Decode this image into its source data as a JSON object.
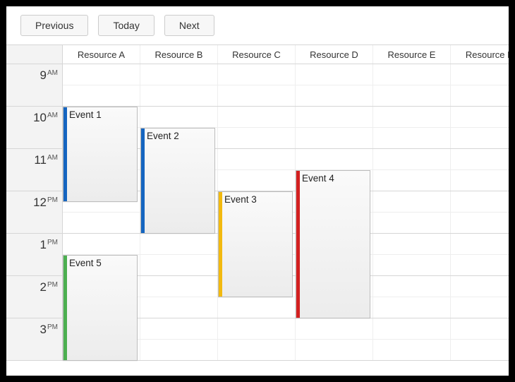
{
  "toolbar": {
    "previous": "Previous",
    "today": "Today",
    "next": "Next"
  },
  "resources": [
    "Resource A",
    "Resource B",
    "Resource C",
    "Resource D",
    "Resource E",
    "Resource F"
  ],
  "startHour": 9,
  "hours": [
    {
      "num": "9",
      "ampm": "AM"
    },
    {
      "num": "10",
      "ampm": "AM"
    },
    {
      "num": "11",
      "ampm": "AM"
    },
    {
      "num": "12",
      "ampm": "PM"
    },
    {
      "num": "1",
      "ampm": "PM"
    },
    {
      "num": "2",
      "ampm": "PM"
    },
    {
      "num": "3",
      "ampm": "PM"
    }
  ],
  "colors": {
    "blue": "#1565c0",
    "yellow": "#f2b90f",
    "red": "#d32020",
    "green": "#4caf50"
  },
  "events": [
    {
      "title": "Event 1",
      "resource": 0,
      "start": 10.0,
      "end": 12.25,
      "color": "blue"
    },
    {
      "title": "Event 2",
      "resource": 1,
      "start": 10.5,
      "end": 13.0,
      "color": "blue"
    },
    {
      "title": "Event 3",
      "resource": 2,
      "start": 12.0,
      "end": 14.5,
      "color": "yellow"
    },
    {
      "title": "Event 4",
      "resource": 3,
      "start": 11.5,
      "end": 15.0,
      "color": "red"
    },
    {
      "title": "Event 5",
      "resource": 0,
      "start": 13.5,
      "end": 16.0,
      "color": "green"
    }
  ]
}
